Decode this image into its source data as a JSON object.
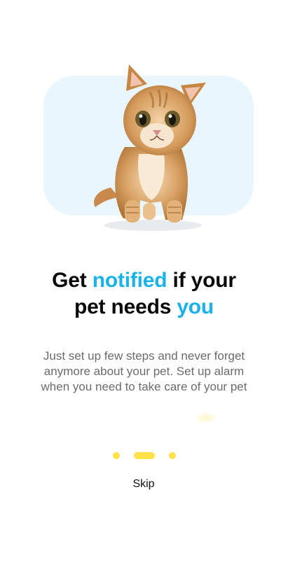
{
  "theme": {
    "accent_color": "#1ab2e8",
    "dot_color": "#ffe24a",
    "card_color": "#eaf6fd"
  },
  "hero": {
    "image_icon": "kitten-illustration"
  },
  "headline": {
    "part1": "Get ",
    "accent1": "notified",
    "part2": " if your",
    "part3": "pet needs ",
    "accent2": "you"
  },
  "description": "Just set up few steps and never forget anymore about your pet. Set up alarm when you need to take care of your pet",
  "pager": {
    "count": 3,
    "active_index": 1
  },
  "skip_label": "Skip"
}
